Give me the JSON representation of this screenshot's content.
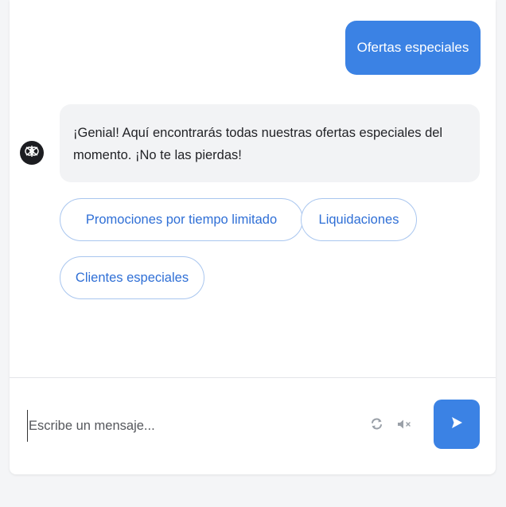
{
  "conversation": {
    "user_message": "Ofertas especiales",
    "bot_message": "¡Genial! Aquí encontrarás todas nuestras ofertas especiales del momento. ¡No te las pierdas!",
    "bot_avatar_icon": "bot-logo-icon",
    "quick_replies": [
      {
        "label": "Promociones por tiempo limitado"
      },
      {
        "label": "Liquidaciones"
      },
      {
        "label": "Clientes especiales"
      }
    ]
  },
  "composer": {
    "placeholder": "Escribe un mensaje...",
    "refresh_icon": "refresh-icon",
    "mute_icon": "volume-mute-icon",
    "send_icon": "send-icon"
  },
  "colors": {
    "accent": "#3b82e4",
    "bot_bubble": "#f2f3f5",
    "quick_reply_border": "#a9c6ef",
    "quick_reply_text": "#2f6fd6"
  }
}
